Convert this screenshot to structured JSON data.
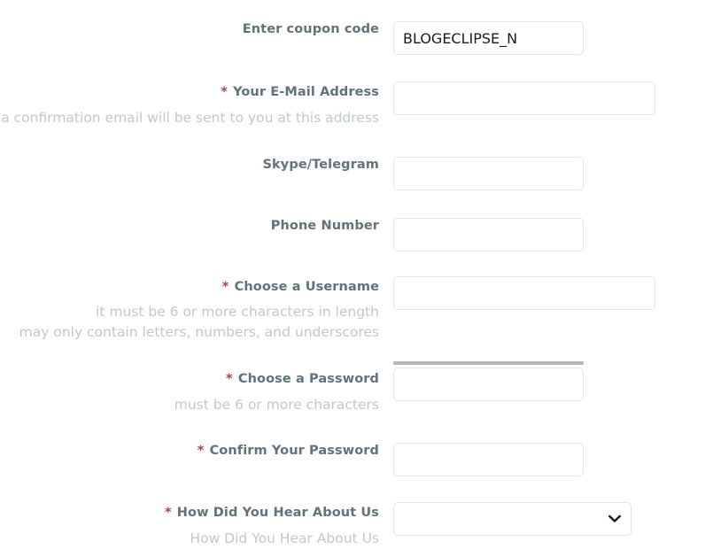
{
  "theme": {
    "background": "#ffffff",
    "label_color": "#62727b",
    "help_color": "#c2c8cc",
    "required_color": "#a94442",
    "input_border": "#e2e4e6",
    "input_text": "#1a1a1a",
    "meter_color": "#b6b9bc"
  },
  "form": {
    "fields": [
      {
        "name": "coupon",
        "label": "Enter coupon code",
        "required": false,
        "value": "BLOGECLIPSE_N",
        "placeholder": "",
        "help": [],
        "type": "text"
      },
      {
        "name": "email",
        "label": "Your E-Mail Address",
        "required": true,
        "value": "",
        "placeholder": "",
        "help": [
          "a confirmation email will be sent to you at this address"
        ],
        "type": "text"
      },
      {
        "name": "skype",
        "label": "Skype/Telegram",
        "required": false,
        "value": "",
        "placeholder": "",
        "help": [],
        "type": "text"
      },
      {
        "name": "phone",
        "label": "Phone Number",
        "required": false,
        "value": "",
        "placeholder": "",
        "help": [],
        "type": "text"
      },
      {
        "name": "username",
        "label": "Choose a Username",
        "required": true,
        "value": "",
        "placeholder": "",
        "help": [
          "it must be 6 or more characters in length",
          "may only contain letters, numbers, and underscores"
        ],
        "type": "text"
      },
      {
        "name": "password",
        "label": "Choose a Password",
        "required": true,
        "value": "",
        "placeholder": "",
        "help": [
          "must be 6 or more characters"
        ],
        "type": "password"
      },
      {
        "name": "confirm-password",
        "label": "Confirm Your Password",
        "required": true,
        "value": "",
        "placeholder": "",
        "help": [],
        "type": "password"
      },
      {
        "name": "referral-source",
        "label": "How Did You Hear About Us",
        "required": true,
        "value": "",
        "placeholder": "",
        "help": [
          "How Did You Hear About Us"
        ],
        "type": "select",
        "selected_option": "",
        "options": [
          ""
        ]
      }
    ],
    "required_marker": "*"
  }
}
